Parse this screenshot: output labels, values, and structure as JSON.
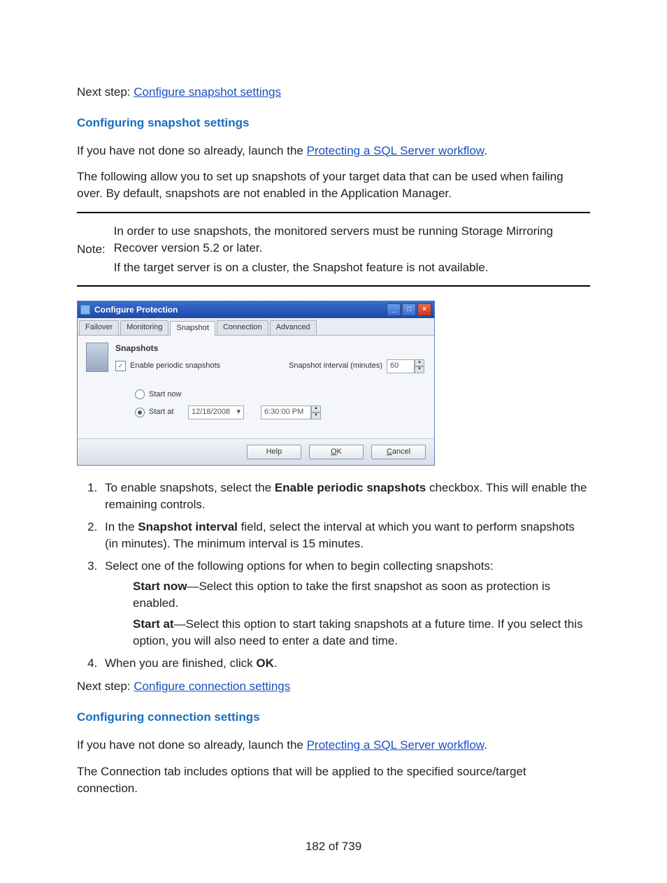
{
  "intro": {
    "next_step_label": "Next step: ",
    "next_step_link": "Configure snapshot settings"
  },
  "section1": {
    "heading": "Configuring snapshot settings",
    "p1a": "If you have not done so already, launch the ",
    "p1_link": "Protecting a SQL Server workflow",
    "p1b": ".",
    "p2": "The following allow you to set up snapshots of your target data that can be used when failing over. By default, snapshots are not enabled in the Application Manager."
  },
  "note": {
    "label": "Note:",
    "line1": "In order to use snapshots, the monitored servers must be running Storage Mirroring Recover version 5.2 or later.",
    "line2": "If the target server is on a cluster, the Snapshot feature is not available."
  },
  "screenshot": {
    "title": "Configure Protection",
    "tabs": [
      "Failover",
      "Monitoring",
      "Snapshot",
      "Connection",
      "Advanced"
    ],
    "active_tab_index": 2,
    "panel_title": "Snapshots",
    "checkbox_label": "Enable periodic snapshots",
    "interval_label": "Snapshot interval (minutes)",
    "interval_value": "60",
    "radio_start_now": "Start now",
    "radio_start_at": "Start at",
    "date_value": "12/18/2008",
    "time_value": "6:30:00 PM",
    "buttons": {
      "help": "Help",
      "ok": "OK",
      "cancel": "Cancel"
    }
  },
  "steps": {
    "s1a": "To enable snapshots, select the ",
    "s1b": "Enable periodic snapshots",
    "s1c": " checkbox. This will enable the remaining controls.",
    "s2a": "In the ",
    "s2b": "Snapshot interval",
    "s2c": " field, select the interval at which you want to perform snapshots (in minutes). The minimum interval is 15 minutes.",
    "s3": "Select one of the following options for when to begin collecting snapshots:",
    "s3_now_a": "Start now",
    "s3_now_b": "—Select this option to take the first snapshot as soon as protection is enabled.",
    "s3_at_a": "Start at",
    "s3_at_b": "—Select this option to start taking snapshots at a future time. If you select this option, you will also need to enter a date and time.",
    "s4a": "When you are finished, click ",
    "s4b": "OK",
    "s4c": "."
  },
  "outro": {
    "next_step_label": "Next step: ",
    "next_step_link": "Configure connection settings"
  },
  "section2": {
    "heading": "Configuring connection settings",
    "p1a": "If you have not done so already, launch the ",
    "p1_link": "Protecting a SQL Server workflow",
    "p1b": ".",
    "p2": "The Connection tab includes options that will be applied to the specified source/target connection."
  },
  "footer": "182 of 739"
}
